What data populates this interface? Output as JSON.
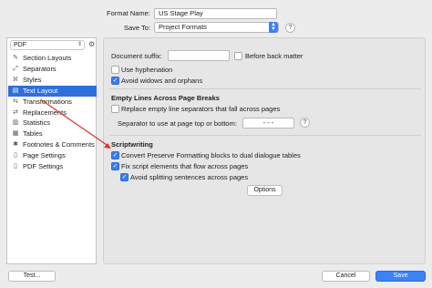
{
  "header": {
    "format_name_label": "Format Name:",
    "format_name_value": "US Stage Play",
    "save_to_label": "Save To:",
    "save_to_value": "Project Formats",
    "help": "?"
  },
  "sidebar": {
    "search_value": "PDF",
    "items": [
      {
        "label": "Section Layouts",
        "icon": "section-layouts-icon",
        "glyph": "✎"
      },
      {
        "label": "Separators",
        "icon": "separators-icon",
        "glyph": "⤢"
      },
      {
        "label": "Styles",
        "icon": "styles-icon",
        "glyph": "ℵ"
      },
      {
        "label": "Text Layout",
        "icon": "text-layout-icon",
        "glyph": "▤",
        "selected": true
      },
      {
        "label": "Transformations",
        "icon": "transformations-icon",
        "glyph": "⇆"
      },
      {
        "label": "Replacements",
        "icon": "replacements-icon",
        "glyph": "⇄"
      },
      {
        "label": "Statistics",
        "icon": "statistics-icon",
        "glyph": "▥"
      },
      {
        "label": "Tables",
        "icon": "tables-icon",
        "glyph": "▦"
      },
      {
        "label": "Footnotes & Comments",
        "icon": "footnotes-icon",
        "glyph": "✱"
      },
      {
        "label": "Page Settings",
        "icon": "page-settings-icon",
        "glyph": "▯"
      },
      {
        "label": "PDF Settings",
        "icon": "pdf-settings-icon",
        "glyph": "▯"
      }
    ]
  },
  "panel": {
    "doc_suffix_label": "Document suffix:",
    "doc_suffix_value": "",
    "before_back_matter": "Before back matter",
    "use_hyphenation": "Use hyphenation",
    "avoid_widows": "Avoid widows and orphans",
    "empty_lines_heading": "Empty Lines Across Page Breaks",
    "replace_empty_lines": "Replace empty line separators that fall across pages",
    "separator_label": "Separator to use at page top or bottom:",
    "separator_value": "- - -",
    "scriptwriting_heading": "Scriptwriting",
    "convert_preserve": "Convert Preserve Formatting blocks to dual dialogue tables",
    "fix_script": "Fix script elements that flow across pages",
    "avoid_splitting": "Avoid splitting sentences across pages",
    "options_button": "Options"
  },
  "footer": {
    "test_button": "Test...",
    "cancel_button": "Cancel",
    "save_button": "Save"
  },
  "checkbox_states": {
    "before_back_matter": false,
    "use_hyphenation": false,
    "avoid_widows": true,
    "replace_empty_lines": false,
    "convert_preserve": true,
    "fix_script": true,
    "avoid_splitting": true
  },
  "colors": {
    "accent": "#3b82f6",
    "selection": "#2f6fdb",
    "annotation_arrow": "#e0322b"
  }
}
